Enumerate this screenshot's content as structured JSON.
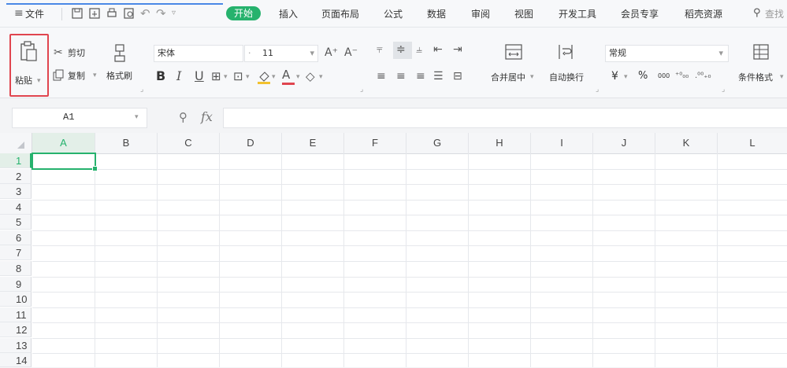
{
  "menu": {
    "file_label": "文件",
    "tabs": [
      "开始",
      "插入",
      "页面布局",
      "公式",
      "数据",
      "审阅",
      "视图",
      "开发工具",
      "会员专享",
      "稻壳资源"
    ],
    "search_placeholder": "查找"
  },
  "ribbon": {
    "paste_label": "粘贴",
    "cut_label": "剪切",
    "copy_label": "复制",
    "format_painter_label": "格式刷",
    "font_name": "宋体",
    "font_size": "11",
    "merge_label": "合并居中",
    "wrap_label": "自动换行",
    "number_format": "常规",
    "currency_symbol": "¥",
    "percent_symbol": "%",
    "thousands_label": "000",
    "conditional_format_label": "条件格式",
    "accent_color": "#26b26d",
    "highlight_color": "#e0454f"
  },
  "formula_bar": {
    "cell_ref": "A1",
    "fx_label": "fx",
    "formula_value": ""
  },
  "sheet": {
    "columns": [
      "A",
      "B",
      "C",
      "D",
      "E",
      "F",
      "G",
      "H",
      "I",
      "J",
      "K",
      "L"
    ],
    "rows": [
      "1",
      "2",
      "3",
      "4",
      "5",
      "6",
      "7",
      "8",
      "9",
      "10",
      "11",
      "12",
      "13",
      "14"
    ],
    "selected_cell": "A1",
    "selection_color": "#26b26d"
  }
}
